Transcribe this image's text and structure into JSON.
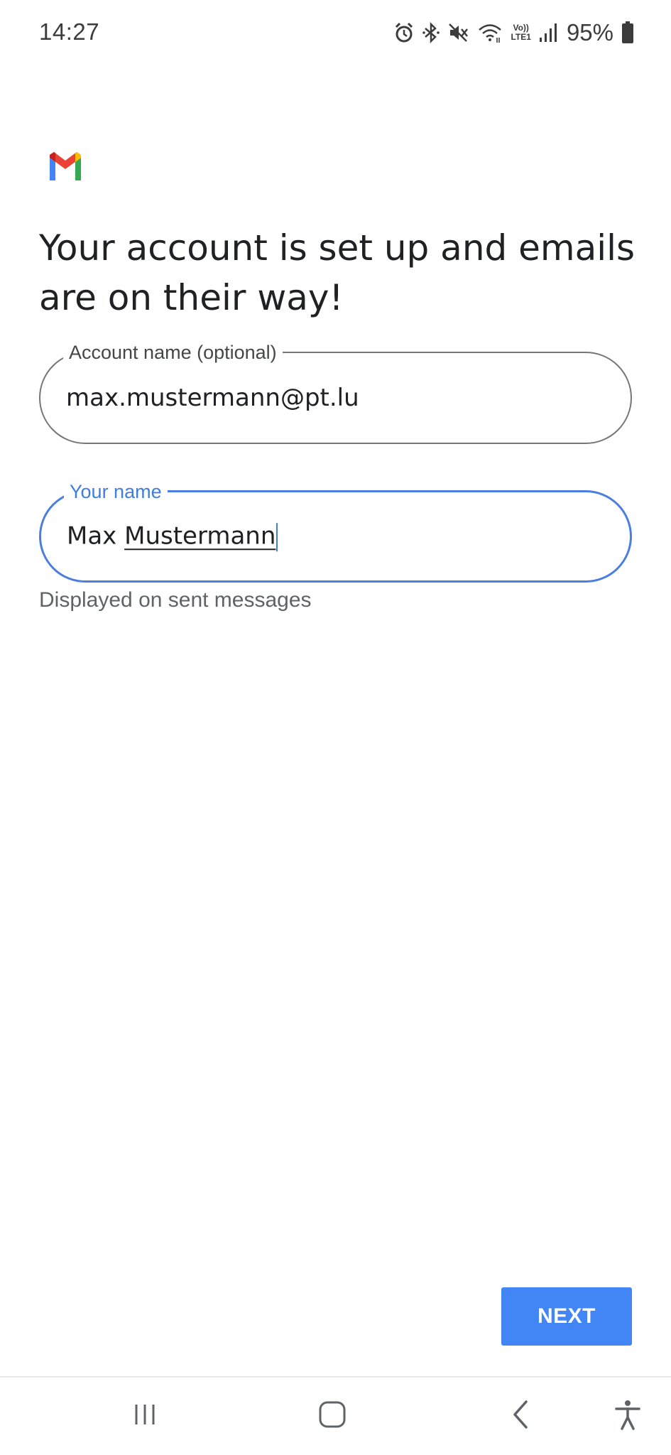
{
  "status_bar": {
    "time": "14:27",
    "icons": [
      "alarm-icon",
      "bluetooth-icon",
      "mute-icon",
      "wifi-icon",
      "volte-lte-icon",
      "signal-icon",
      "battery-icon"
    ],
    "volte_top": "Vo))",
    "volte_bottom": "LTE1",
    "battery": "95%"
  },
  "app": {
    "logo": "gmail-logo",
    "headline": "Your account is set up and emails are on their way!"
  },
  "form": {
    "account_name": {
      "label": "Account name (optional)",
      "value": "max.mustermann@pt.lu"
    },
    "your_name": {
      "label": "Your name",
      "value_first": "Max",
      "value_last": "Mustermann",
      "helper": "Displayed on sent messages"
    }
  },
  "actions": {
    "next_label": "NEXT"
  },
  "nav_bar": {
    "icons": [
      "recent-apps-icon",
      "home-icon",
      "back-icon",
      "accessibility-icon"
    ]
  },
  "colors": {
    "accent": "#4285f4",
    "focus_border": "#4a7fe0",
    "gmail_red": "#ea4335",
    "gmail_blue": "#4285f4",
    "gmail_green": "#34a853",
    "gmail_yellow": "#fbbc04"
  }
}
